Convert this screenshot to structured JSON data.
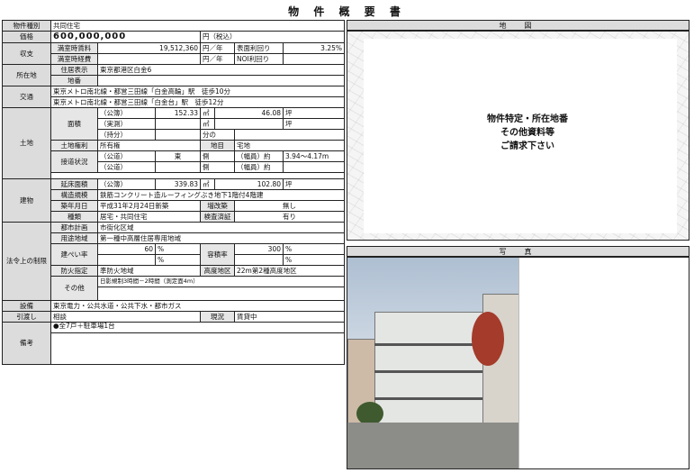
{
  "page": {
    "title": "物 件 概 要 書"
  },
  "sheet": {
    "type_label": "物件種別",
    "type_value": "共同住宅",
    "price_label": "価格",
    "price_value": "600,000,000",
    "price_unit": "円（税込）",
    "income_label": "収支",
    "income_full_label": "満室時賃料",
    "income_full_value": "19,512,360",
    "income_full_unit": "円／年",
    "yield_gross_label": "表面利回り",
    "yield_gross_value": "3.25%",
    "expense_label": "満室時経費",
    "expense_unit": "円／年",
    "yield_noi_label": "NOI利回り",
    "location_label": "所在地",
    "address_display_label": "住居表示",
    "address_display_value": "東京都港区白金6",
    "lot_label": "地番",
    "traffic_label": "交通",
    "traffic_1": "東京メトロ南北線・都営三田線「白金高輪」駅　徒歩10分",
    "traffic_2": "東京メトロ南北線・都営三田線「白金台」駅　徒歩12分",
    "land_label": "土地",
    "area_label": "面積",
    "land_official_label": "（公簿）",
    "land_official_m2": "152.33",
    "land_official_tsubo": "46.08",
    "land_actual_label": "（実測）",
    "land_share_label": "（持分）",
    "land_share_unit": "分の",
    "unit_m2": "㎡",
    "unit_tsubo": "坪",
    "land_right_label": "土地権利",
    "land_right_value": "所有権",
    "land_category_label": "地目",
    "land_category_value": "宅地",
    "road_label": "接道状況",
    "road_1_label": "（公道）",
    "road_1_dir": "東",
    "road_side": "側",
    "road_width_label": "（幅員）約",
    "road_1_width": "3.94～4.17m",
    "road_2_label": "（公道）",
    "building_label": "建物",
    "floor_area_label": "延床面積",
    "floor_area_official": "（公簿）",
    "floor_area_m2": "339.83",
    "floor_area_tsubo": "102.80",
    "structure_label": "構造規模",
    "structure_value": "鉄筋コンクリート造ルーフィングぶき地下1階付4階建",
    "built_label": "築年月日",
    "built_value": "平成31年2月24日新築",
    "extension_label": "増改築",
    "extension_value": "無し",
    "kind_label": "種類",
    "kind_value": "居宅・共同住宅",
    "inspection_label": "検査済証",
    "inspection_value": "有り",
    "law_label": "法令上の制限",
    "city_plan_label": "都市計画",
    "city_plan_value": "市街化区域",
    "zone_label": "用途地域",
    "zone_value": "第一種中高層住居専用地域",
    "bcr_label": "建ぺい率",
    "bcr_value": "60",
    "far_label": "容積率",
    "far_value": "300",
    "percent": "%",
    "fire_label": "防火指定",
    "fire_value": "準防火地域",
    "height_label": "高度地区",
    "height_value": "22m第2種高度地区",
    "other_label": "その他",
    "other_value": "日影規制3時間－2時間（測定面4m）",
    "utilities_label": "設備",
    "utilities_value": "東京電力・公共水道・公共下水・都市ガス",
    "delivery_label": "引渡し",
    "delivery_value": "相談",
    "status_label": "現況",
    "status_value": "賃貸中",
    "remarks_label": "備考",
    "remarks_value": "●全7戸＋駐車場1台"
  },
  "map": {
    "heading": "地　図",
    "note_1": "物件特定・所在地番",
    "note_2": "その他資料等",
    "note_3": "ご請求下さい"
  },
  "photo": {
    "heading": "写　真"
  }
}
